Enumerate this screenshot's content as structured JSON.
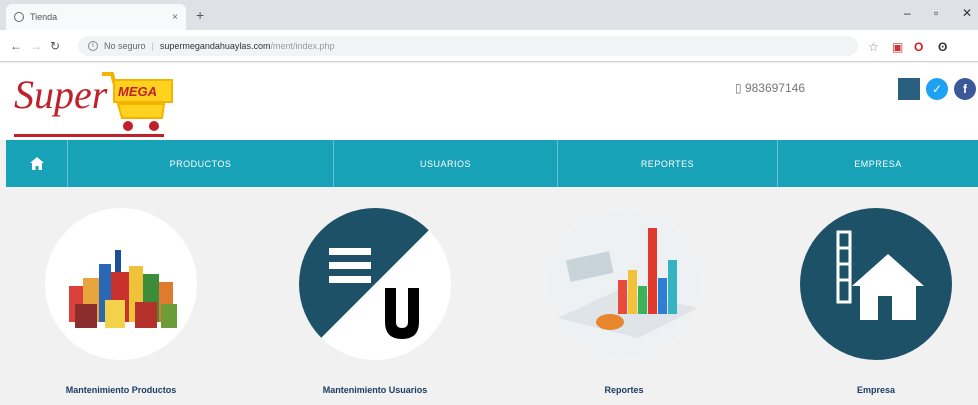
{
  "browser": {
    "tab_title": "Tienda",
    "tab_close": "×",
    "new_tab": "+",
    "security_label": "No seguro",
    "url_host": "supermegandahuaylas.com",
    "url_path": "/ment/index.php",
    "win_minimize": "–",
    "win_maximize": "▫",
    "win_close": "✕"
  },
  "header": {
    "logo_word": "Super",
    "logo_badge": "MEGA",
    "phone": "983697146"
  },
  "nav": {
    "items": [
      {
        "label": "PRODUCTOS"
      },
      {
        "label": "USUARIOS"
      },
      {
        "label": "REPORTES"
      },
      {
        "label": "EMPRESA"
      }
    ]
  },
  "cards": [
    {
      "label": "Mantenimiento Productos",
      "icon": "grocery-products-image"
    },
    {
      "label": "Mantenimiento Usuarios",
      "icon": "users-u-icon"
    },
    {
      "label": "Reportes",
      "icon": "bar-chart-report-image"
    },
    {
      "label": "Empresa",
      "icon": "house-building-icon"
    }
  ],
  "colors": {
    "nav_bg": "#17a2b8",
    "card_dark": "#1d5168",
    "label": "#1d3c63",
    "brand_red": "#c0202a",
    "brand_yellow": "#ffd21f"
  }
}
